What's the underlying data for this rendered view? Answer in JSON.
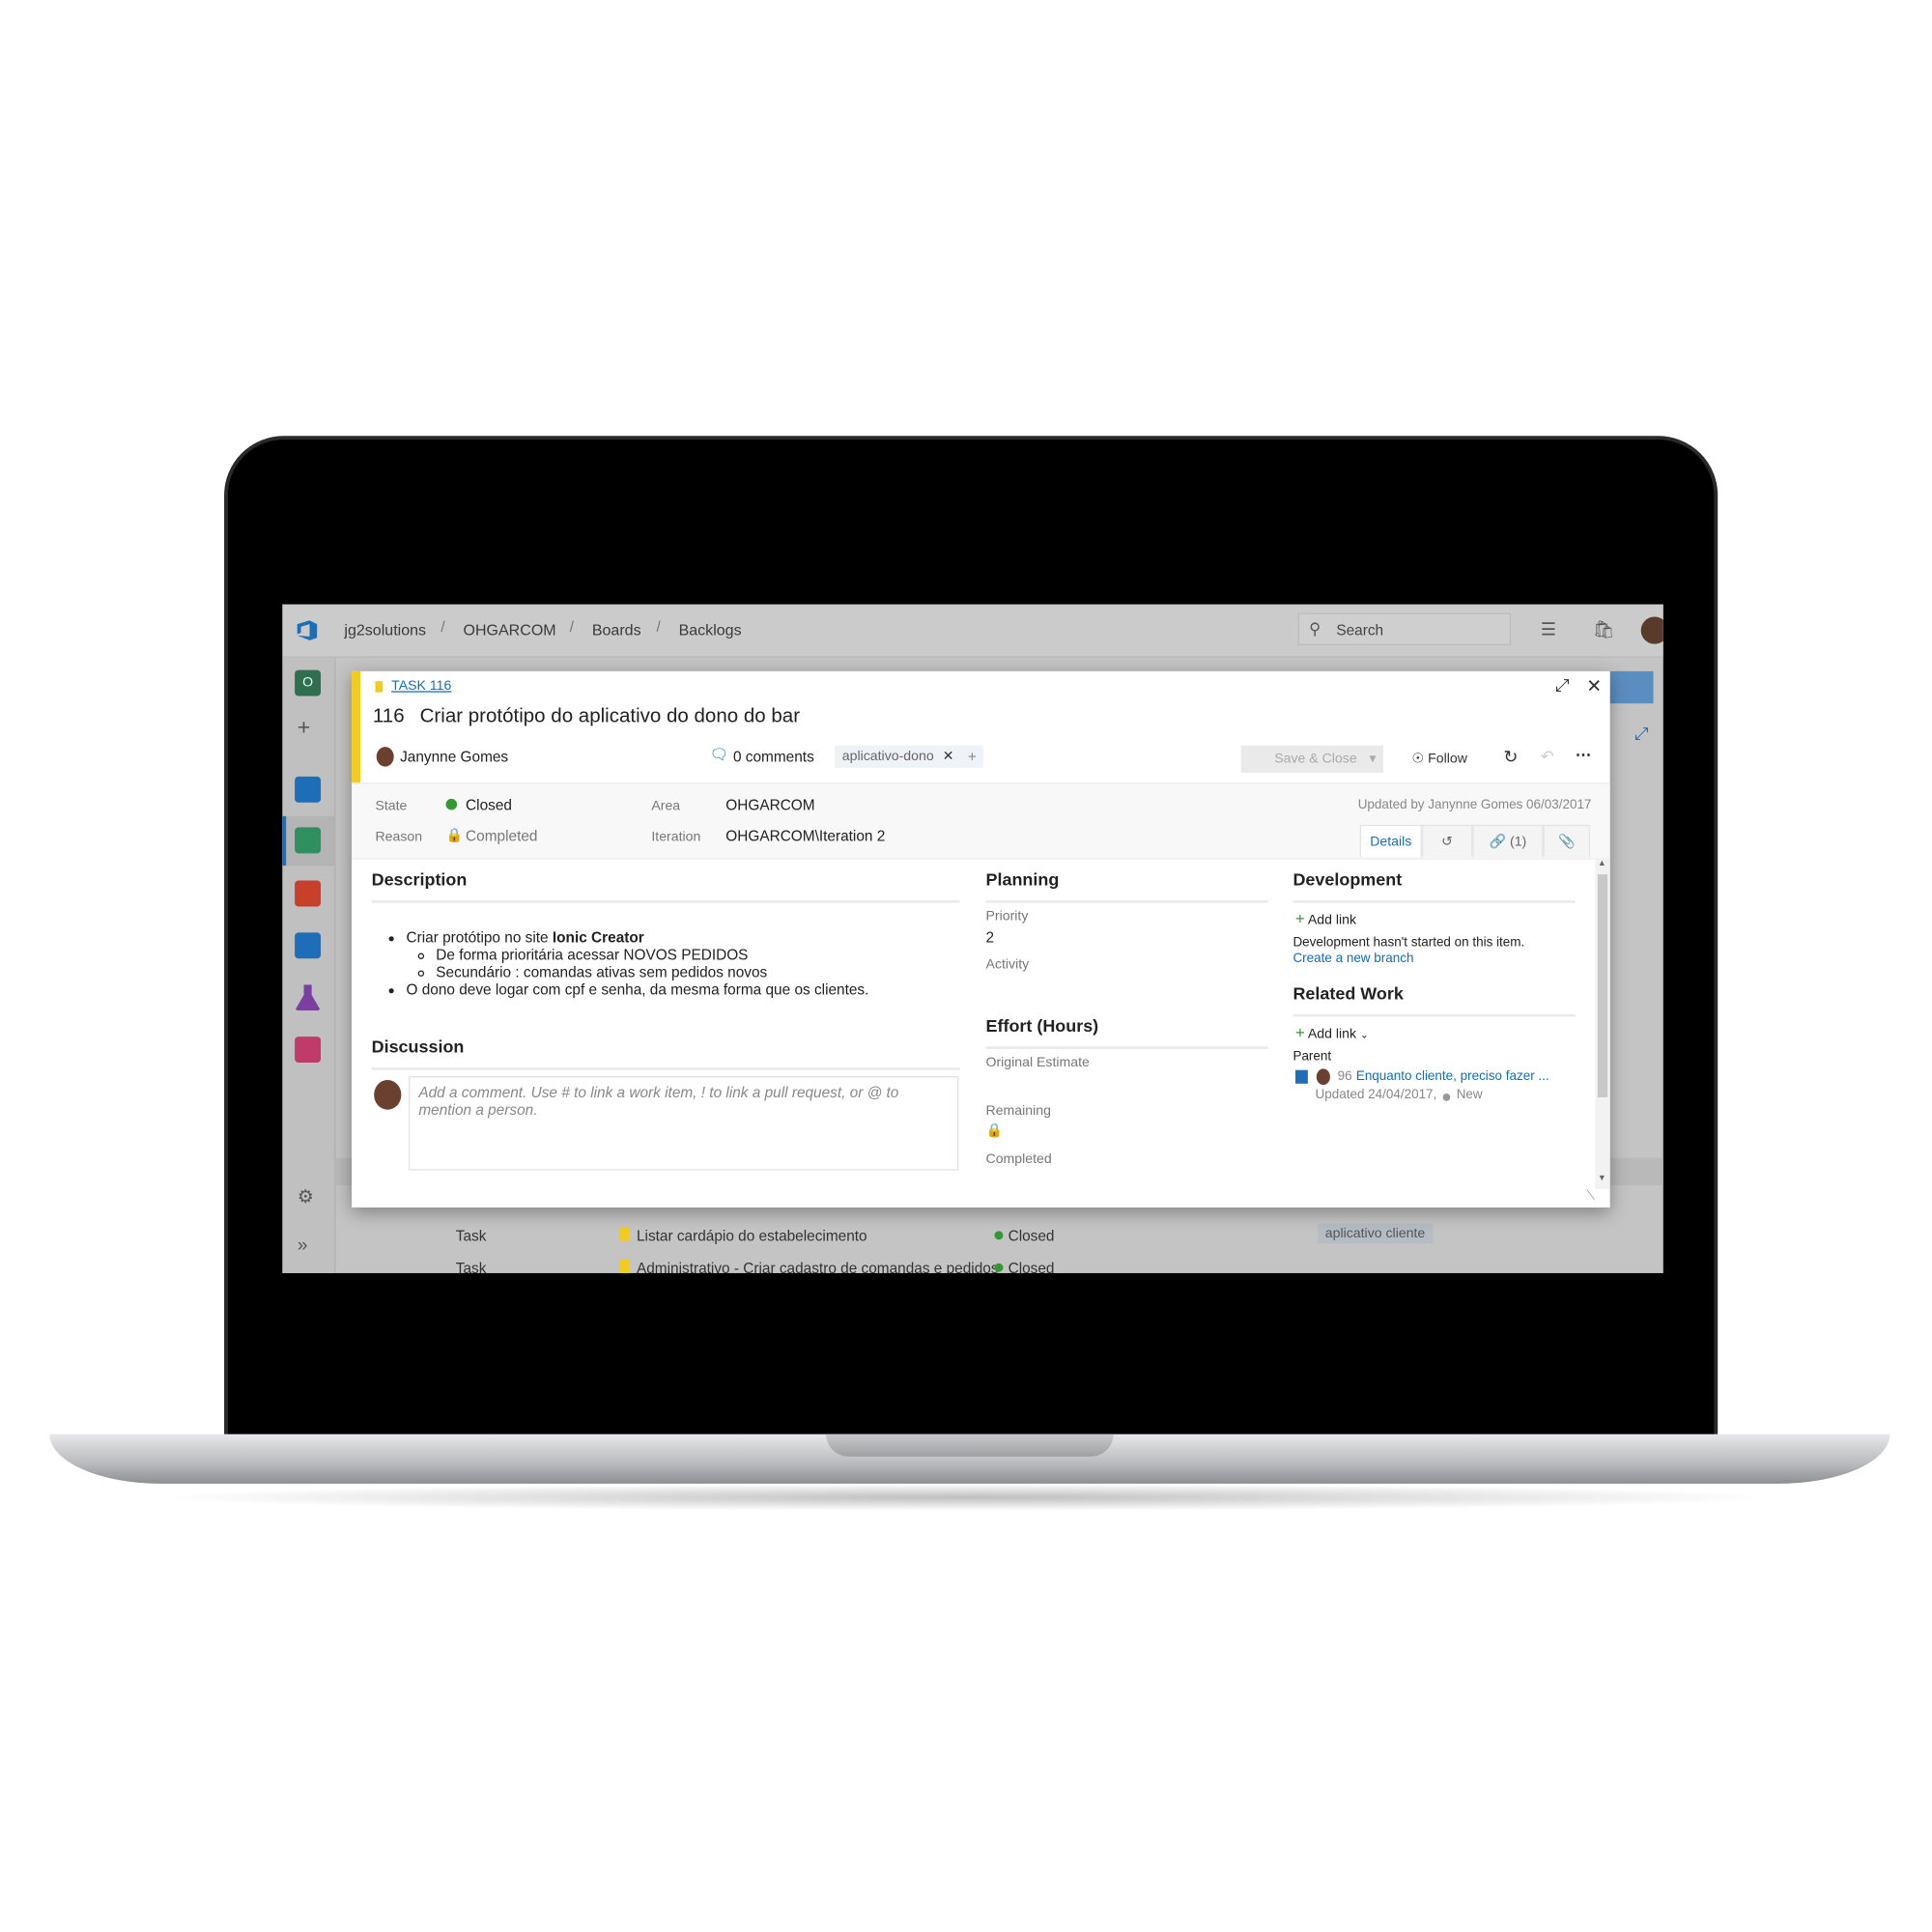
{
  "topbar": {
    "breadcrumb": [
      "jg2solutions",
      "OHGARCOM",
      "Boards",
      "Backlogs"
    ],
    "search_placeholder": "Search"
  },
  "sidebar": {
    "project_initial": "O"
  },
  "dialog": {
    "type_link": "TASK 116",
    "id": "116",
    "title": "Criar protótipo do aplicativo do dono do bar",
    "assignee": "Janynne Gomes",
    "comments": "0 comments",
    "tag": "aplicativo-dono",
    "save_close": "Save & Close",
    "follow": "Follow",
    "fields": {
      "state_label": "State",
      "state": "Closed",
      "reason_label": "Reason",
      "reason": "Completed",
      "area_label": "Area",
      "area": "OHGARCOM",
      "iteration_label": "Iteration",
      "iteration": "OHGARCOM\\Iteration 2"
    },
    "updated": "Updated by Janynne Gomes 06/03/2017",
    "tabs": {
      "details": "Details",
      "links": "(1)"
    },
    "description": {
      "heading": "Description",
      "item1_pre": "Criar protótipo no site ",
      "item1_bold": "Ionic Creator",
      "sub1": "De forma prioritária acessar NOVOS PEDIDOS",
      "sub2": "Secundário : comandas ativas sem pedidos novos",
      "item2": "O dono deve logar com cpf e senha, da mesma forma que os clientes."
    },
    "discussion": {
      "heading": "Discussion",
      "placeholder": "Add a comment. Use # to link a work item, ! to link a pull request, or @ to mention a person."
    },
    "planning": {
      "heading": "Planning",
      "priority_label": "Priority",
      "priority": "2",
      "activity_label": "Activity"
    },
    "effort": {
      "heading": "Effort (Hours)",
      "original": "Original Estimate",
      "remaining": "Remaining",
      "completed": "Completed"
    },
    "development": {
      "heading": "Development",
      "add_link": "Add link",
      "note": "Development hasn't started on this item.",
      "create_branch": "Create a new branch"
    },
    "related": {
      "heading": "Related Work",
      "add_link": "Add link",
      "parent_label": "Parent",
      "parent_id": "96",
      "parent_title": "Enquanto cliente, preciso fazer ...",
      "parent_updated": "Updated 24/04/2017,",
      "parent_state": "New"
    }
  },
  "background_rows": [
    {
      "type": "Task",
      "title": "Listar cardápio do estabelecimento",
      "state": "Closed",
      "tag": "aplicativo cliente"
    },
    {
      "type": "Task",
      "title": "Administrativo - Criar cadastro de comandas e pedidos",
      "state": "Closed"
    }
  ],
  "colors": {
    "accent": "#106ebe",
    "task_yellow": "#f2cb1d",
    "closed_green": "#339933"
  }
}
